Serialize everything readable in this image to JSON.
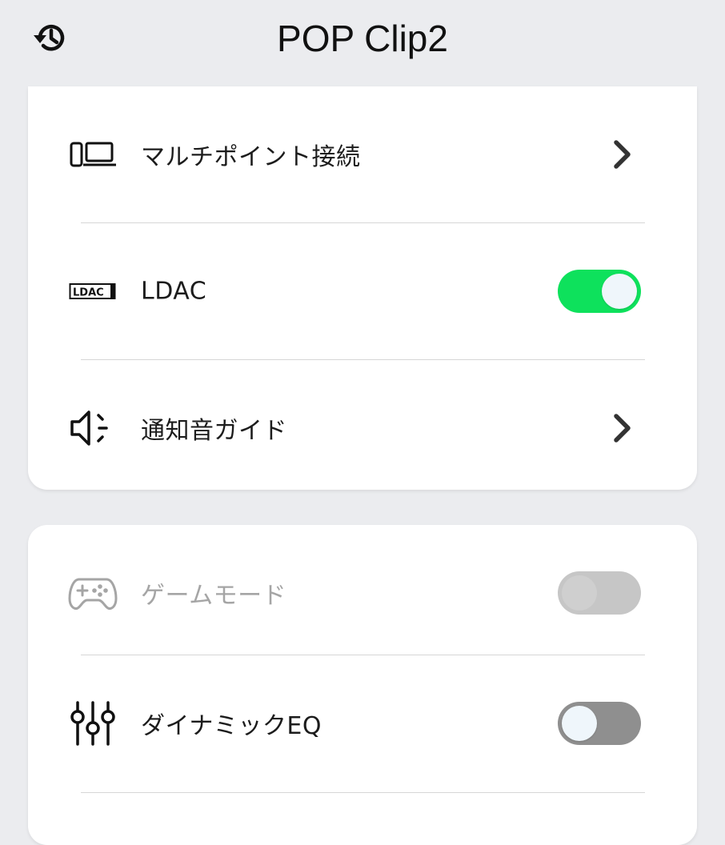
{
  "header": {
    "title": "POP Clip2",
    "history_icon": "history-icon"
  },
  "colors": {
    "background": "#ebecef",
    "toggle_on": "#0ee15c",
    "toggle_off": "#8f8f8f",
    "toggle_disabled": "#c6c6c6",
    "knob": "#eff6fb",
    "knob_disabled": "#cfcfcf"
  },
  "card1": {
    "rows": [
      {
        "label": "マルチポイント接続",
        "icon": "multipoint-devices-icon",
        "control": "chevron"
      },
      {
        "label": "LDAC",
        "icon": "ldac-icon",
        "icon_text": "LDAC",
        "control": "toggle",
        "state": "on"
      },
      {
        "label": "通知音ガイド",
        "icon": "speaker-notification-icon",
        "control": "chevron"
      }
    ]
  },
  "card2": {
    "rows": [
      {
        "label": "ゲームモード",
        "icon": "gamepad-icon",
        "control": "toggle",
        "state": "disabled"
      },
      {
        "label": "ダイナミックEQ",
        "icon": "equalizer-sliders-icon",
        "control": "toggle",
        "state": "off"
      }
    ]
  }
}
